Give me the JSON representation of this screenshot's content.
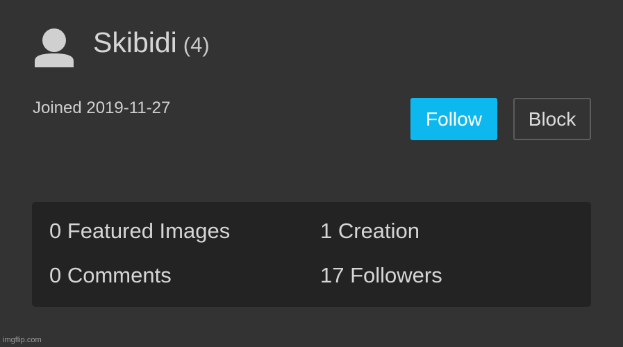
{
  "profile": {
    "avatar_icon": "default-user-avatar-icon",
    "username": "Skibidi",
    "points": "(4)",
    "joined": "Joined 2019-11-27"
  },
  "actions": {
    "follow_label": "Follow",
    "block_label": "Block"
  },
  "stats": {
    "featured_images": "0 Featured Images",
    "creations": "1 Creation",
    "comments": "0 Comments",
    "followers": "17 Followers"
  },
  "watermark": "imgflip.com",
  "colors": {
    "background": "#333333",
    "stats_panel": "#232323",
    "follow_button": "#0db8ef"
  }
}
